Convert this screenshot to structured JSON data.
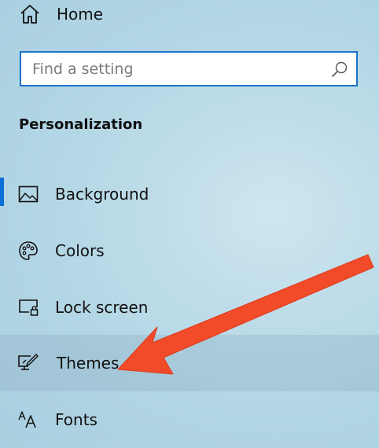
{
  "home": {
    "label": "Home",
    "icon": "home-icon"
  },
  "search": {
    "placeholder": "Find a setting",
    "value": "",
    "icon": "search-icon"
  },
  "section": {
    "title": "Personalization"
  },
  "nav": {
    "items": [
      {
        "label": "Background",
        "icon": "picture-icon",
        "selected": true
      },
      {
        "label": "Colors",
        "icon": "palette-icon"
      },
      {
        "label": "Lock screen",
        "icon": "lock-screen-icon"
      },
      {
        "label": "Themes",
        "icon": "themes-icon",
        "hovered": true
      },
      {
        "label": "Fonts",
        "icon": "fonts-icon"
      }
    ]
  },
  "colors": {
    "accent": "#0a6fd6",
    "search_border": "#1a73c8",
    "annotation_arrow": "#f24b2a"
  }
}
